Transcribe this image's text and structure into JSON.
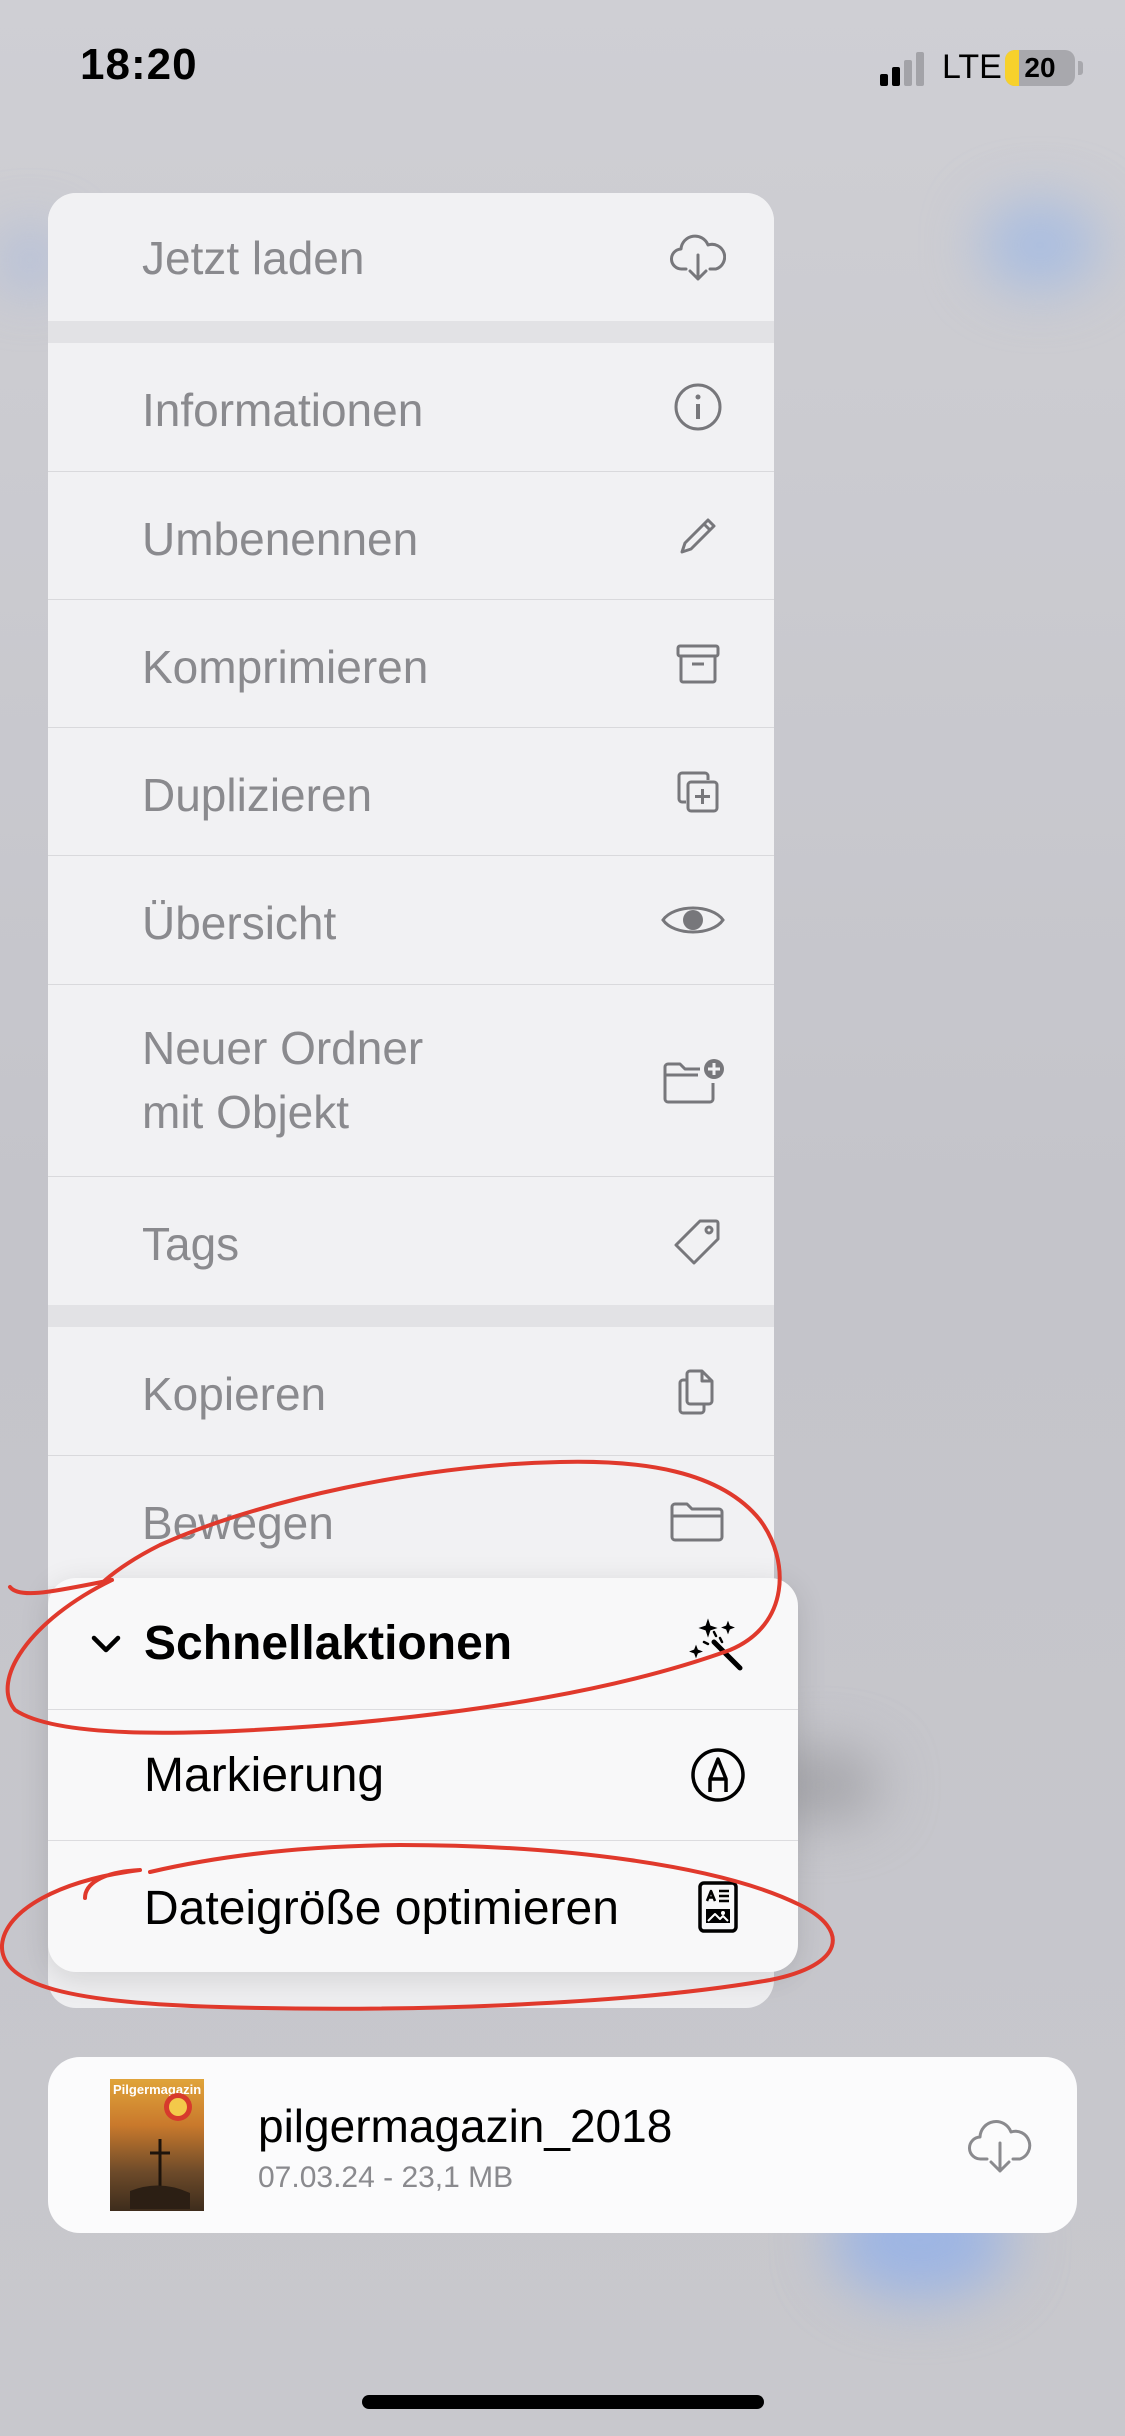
{
  "status_bar": {
    "time": "18:20",
    "network": "LTE",
    "battery_level": "20",
    "battery_fraction": 0.2
  },
  "context_menu": {
    "load_now": {
      "label": "Jetzt laden",
      "icon": "cloud-download-icon"
    },
    "items": [
      {
        "label": "Informationen",
        "icon": "info-icon"
      },
      {
        "label": "Umbenennen",
        "icon": "pencil-icon"
      },
      {
        "label": "Komprimieren",
        "icon": "archive-box-icon"
      },
      {
        "label": "Duplizieren",
        "icon": "duplicate-icon"
      },
      {
        "label": "Übersicht",
        "icon": "eye-icon"
      },
      {
        "label_line1": "Neuer Ordner",
        "label_line2": "mit Objekt",
        "icon": "folder-add-icon"
      },
      {
        "label": "Tags",
        "icon": "tag-icon"
      }
    ],
    "copy": {
      "label": "Kopieren",
      "icon": "copy-icon"
    },
    "move": {
      "label": "Bewegen",
      "icon": "folder-icon"
    }
  },
  "quick_actions": {
    "header": "Schnellaktionen",
    "header_icon": "magic-wand-icon",
    "items": [
      {
        "label": "Markierung",
        "icon": "markup-icon"
      },
      {
        "label": "Dateigröße optimieren",
        "icon": "optimize-file-icon"
      }
    ]
  },
  "file": {
    "thumbnail_title": "Pilgermagazin",
    "name": "pilgermagazin_2018",
    "meta": "07.03.24 - 23,1 MB",
    "download_icon": "cloud-download-icon"
  },
  "colors": {
    "annotation": "#e0392c",
    "menu_text": "#8a8a8e",
    "battery": "#f7d12b"
  }
}
